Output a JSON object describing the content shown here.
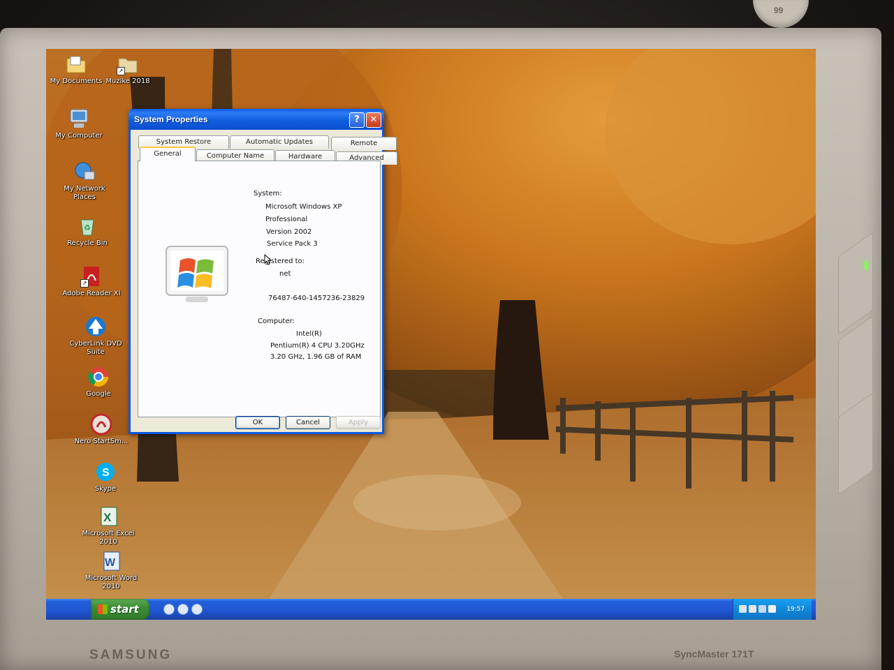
{
  "desktop": {
    "icons": [
      {
        "name": "My Documents",
        "icon": "folder-documents-icon"
      },
      {
        "name": "Muzike 2018",
        "icon": "folder-shortcut-icon"
      },
      {
        "name": "My Computer",
        "icon": "computer-icon"
      },
      {
        "name": "My Network Places",
        "icon": "network-icon"
      },
      {
        "name": "Recycle Bin",
        "icon": "recycle-bin-icon"
      },
      {
        "name": "Adobe Reader XI",
        "icon": "pdf-icon"
      },
      {
        "name": "CyberLink DVD Suite",
        "icon": "cyberlink-icon"
      },
      {
        "name": "Google",
        "icon": "chrome-icon"
      },
      {
        "name": "Nero StartSm...",
        "icon": "nero-icon"
      },
      {
        "name": "Skype",
        "icon": "skype-icon"
      },
      {
        "name": "Microsoft Excel 2010",
        "icon": "excel-icon"
      },
      {
        "name": "Microsoft Word 2010",
        "icon": "word-icon"
      }
    ]
  },
  "dialog": {
    "title": "System Properties",
    "help_label": "?",
    "close_label": "✕",
    "tabs_row1": [
      "System Restore",
      "Automatic Updates",
      "Remote"
    ],
    "tabs_row2": [
      "General",
      "Computer Name",
      "Hardware",
      "Advanced"
    ],
    "active_tab": "General",
    "system_heading": "System:",
    "system_lines": [
      "Microsoft Windows XP",
      "Professional",
      "Version 2002",
      "Service Pack 3"
    ],
    "registered_heading": "Registered to:",
    "registered_name": "net",
    "product_id": "76487-640-1457236-23829",
    "computer_heading": "Computer:",
    "computer_lines": [
      "Intel(R)",
      "Pentium(R) 4 CPU 3.20GHz",
      "3.20 GHz, 1.96 GB of RAM"
    ],
    "buttons": {
      "ok": "OK",
      "cancel": "Cancel",
      "apply": "Apply"
    }
  },
  "taskbar": {
    "start_label": "start",
    "clock": "19:57"
  },
  "monitor": {
    "brand": "SAMSUNG",
    "model": "SyncMaster 171T",
    "cap_text": "99"
  },
  "colors": {
    "taskbar_blue": "#245edb",
    "start_green": "#3c8f35",
    "dialog_face": "#ece9d8",
    "title_blue": "#0a5ae8"
  }
}
